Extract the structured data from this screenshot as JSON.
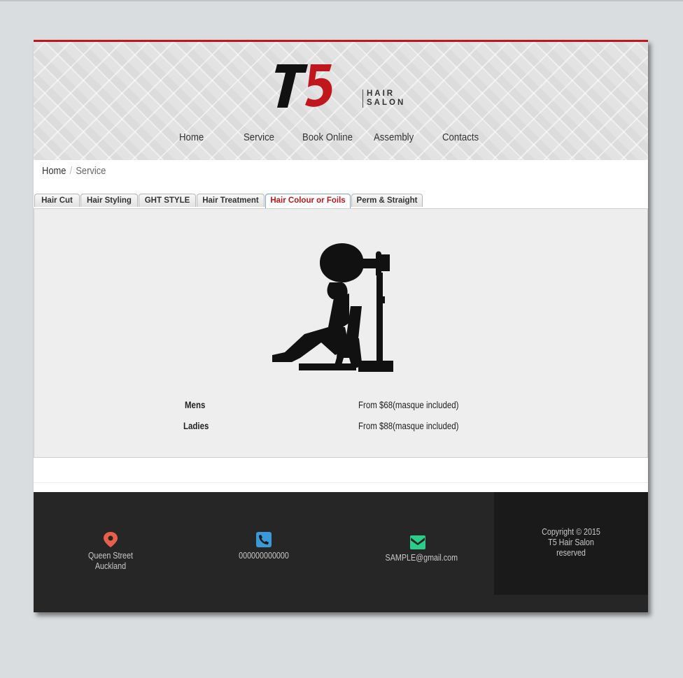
{
  "brand": {
    "logo_text": "T5",
    "tagline_line1": "HAIR",
    "tagline_line2": "SALON"
  },
  "nav": {
    "items": [
      "Home",
      "Service",
      "Book Online",
      "Assembly",
      "Contacts"
    ]
  },
  "breadcrumb": {
    "home": "Home",
    "separator": "/",
    "current": "Service"
  },
  "tabs": [
    {
      "label": "Hair Cut"
    },
    {
      "label": "Hair Styling"
    },
    {
      "label": "GHT STYLE"
    },
    {
      "label": "Hair Treatment"
    },
    {
      "label": "Hair Colour or Foils",
      "active": true
    },
    {
      "label": "Perm & Straight"
    }
  ],
  "service": {
    "prices": [
      {
        "label": "Mens",
        "value": "From $68(masque included)"
      },
      {
        "label": "Ladies",
        "value": "From $88(masque included)"
      }
    ]
  },
  "footer": {
    "address": {
      "line1": "Queen Street",
      "line2": "Auckland",
      "icon": "location-pin-icon"
    },
    "phone": {
      "value": "000000000000",
      "icon": "phone-icon"
    },
    "email": {
      "value": "SAMPLE@gmail.com",
      "icon": "envelope-icon"
    },
    "copyright": {
      "line1": "Copyright © 2015",
      "line2": "T5 Hair Salon",
      "line3": "reserved"
    }
  },
  "colors": {
    "accent": "#c0171c",
    "footer_bg": "#262626",
    "pin": "#e8604c",
    "phone": "#3a9ad9",
    "email": "#2ecc8a"
  }
}
